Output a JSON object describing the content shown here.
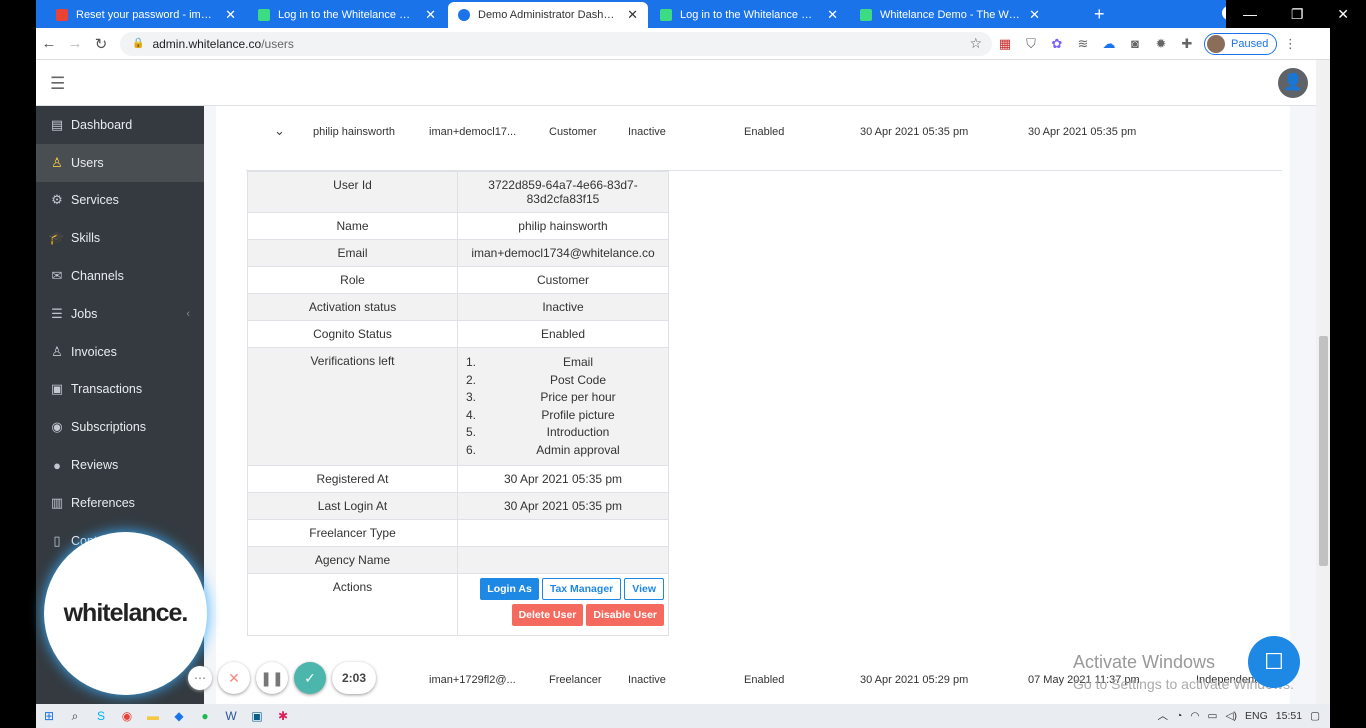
{
  "browser": {
    "tabs": [
      {
        "title": "Reset your password - iman@wh",
        "color": "#ea4335"
      },
      {
        "title": "Log in to the Whitelance market",
        "color": "#3ddc84"
      },
      {
        "title": "Demo Administrator Dashboard",
        "color": "#1a73e8"
      },
      {
        "title": "Log in to the Whitelance market",
        "color": "#3ddc84"
      },
      {
        "title": "Whitelance Demo - The White La",
        "color": "#3ddc84"
      }
    ],
    "url_host": "admin.whitelance.co",
    "url_path": "/users",
    "profile_status": "Paused"
  },
  "sidebar": {
    "items": [
      {
        "label": "Dashboard",
        "icon": "▤"
      },
      {
        "label": "Users",
        "icon": "♙"
      },
      {
        "label": "Services",
        "icon": "⚙"
      },
      {
        "label": "Skills",
        "icon": "🎓"
      },
      {
        "label": "Channels",
        "icon": "✉"
      },
      {
        "label": "Jobs",
        "icon": "☰"
      },
      {
        "label": "Invoices",
        "icon": "♙"
      },
      {
        "label": "Transactions",
        "icon": "▣"
      },
      {
        "label": "Subscriptions",
        "icon": "◉"
      },
      {
        "label": "Reviews",
        "icon": "●"
      },
      {
        "label": "References",
        "icon": "▥"
      },
      {
        "label": "Cont",
        "icon": "▯"
      }
    ]
  },
  "users": {
    "row1": {
      "name": "philip hainsworth",
      "email": "iman+democl17...",
      "role": "Customer",
      "activation": "Inactive",
      "cognito": "Enabled",
      "registered": "30 Apr 2021 05:35 pm",
      "last_login": "30 Apr 2021 05:35 pm"
    },
    "row2": {
      "email": "iman+1729fl2@...",
      "role": "Freelancer",
      "activation": "Inactive",
      "cognito": "Enabled",
      "registered": "30 Apr 2021 05:29 pm",
      "last_login": "07 May 2021 11:37 pm",
      "type": "Independent F..."
    }
  },
  "detail": {
    "user_id_label": "User Id",
    "user_id": "3722d859-64a7-4e66-83d7-83d2cfa83f15",
    "name_label": "Name",
    "name": "philip hainsworth",
    "email_label": "Email",
    "email": "iman+democl1734@whitelance.co",
    "role_label": "Role",
    "role": "Customer",
    "activation_label": "Activation status",
    "activation": "Inactive",
    "cognito_label": "Cognito Status",
    "cognito": "Enabled",
    "verifications_label": "Verifications left",
    "verifications": [
      {
        "n": "1.",
        "t": "Email"
      },
      {
        "n": "2.",
        "t": "Post Code"
      },
      {
        "n": "3.",
        "t": "Price per hour"
      },
      {
        "n": "4.",
        "t": "Profile picture"
      },
      {
        "n": "5.",
        "t": "Introduction"
      },
      {
        "n": "6.",
        "t": "Admin approval"
      }
    ],
    "registered_label": "Registered At",
    "registered": "30 Apr 2021 05:35 pm",
    "last_login_label": "Last Login At",
    "last_login": "30 Apr 2021 05:35 pm",
    "freelancer_type_label": "Freelancer Type",
    "freelancer_type": "",
    "agency_label": "Agency Name",
    "agency": "",
    "actions_label": "Actions",
    "btn_login_as": "Login As",
    "btn_tax": "Tax Manager",
    "btn_view": "View",
    "btn_delete": "Delete User",
    "btn_disable": "Disable User"
  },
  "overlay": {
    "logo_text": "whitelance.",
    "timer": "2:03",
    "activate_title": "Activate Windows",
    "activate_sub": "Go to Settings to activate Windows."
  },
  "taskbar": {
    "lang": "ENG",
    "time": "15:51"
  }
}
